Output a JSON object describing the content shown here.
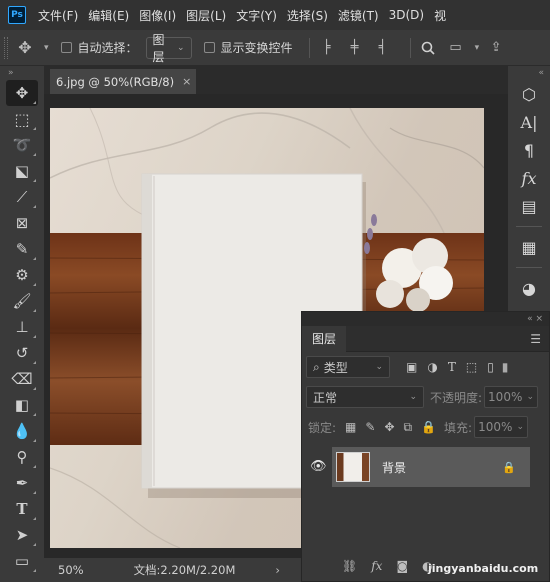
{
  "menubar": {
    "logo": "Ps",
    "items": [
      "文件(F)",
      "编辑(E)",
      "图像(I)",
      "图层(L)",
      "文字(Y)",
      "选择(S)",
      "滤镜(T)",
      "3D(D)",
      "视"
    ]
  },
  "options": {
    "move_icon": "move-icon",
    "auto_select_label": "自动选择：",
    "auto_select_target": "图层",
    "show_transform_label": "显示变换控件"
  },
  "document": {
    "tab_title": "6.jpg @ 50%(RGB/8)",
    "close": "×"
  },
  "status": {
    "zoom": "50%",
    "doc_size": "文档:2.20M/2.20M",
    "arrow": "›"
  },
  "layers_panel": {
    "title": "图层",
    "filter_kind": "类型",
    "blend_mode": "正常",
    "opacity_label": "不透明度:",
    "opacity_value": "100%",
    "lock_label": "锁定:",
    "fill_label": "填充:",
    "fill_value": "100%",
    "layers": [
      {
        "name": "背景",
        "visible": true,
        "locked": true
      }
    ]
  },
  "watermark": "jingyanbaidu.com",
  "colors": {
    "app_bg": "#323232",
    "panel_bg": "#383838",
    "accent": "#31a8ff",
    "selected_layer": "#5a5a5a"
  }
}
